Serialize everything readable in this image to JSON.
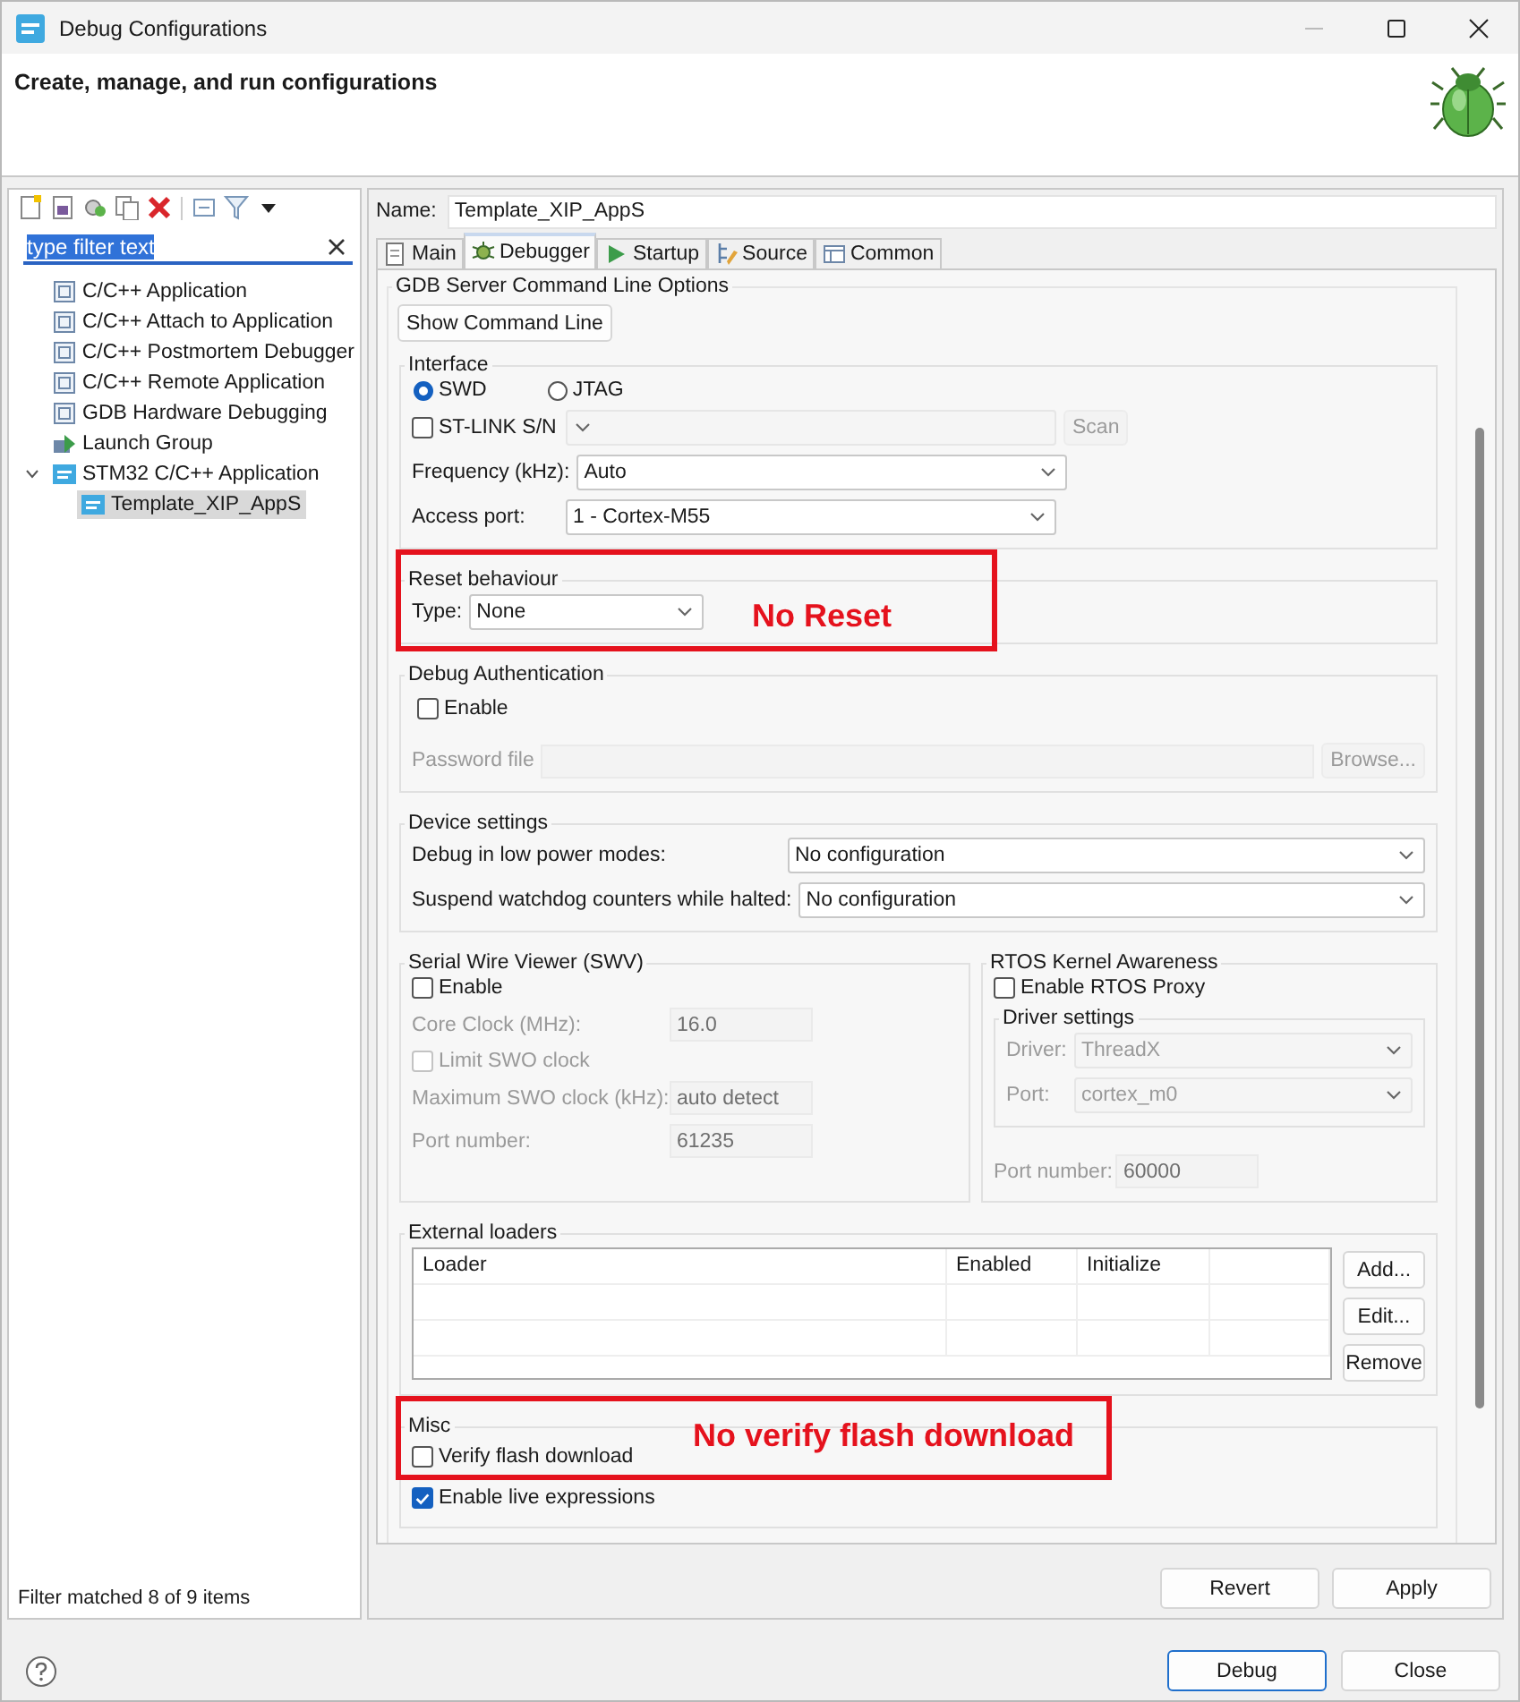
{
  "window": {
    "title": "Debug Configurations"
  },
  "header": {
    "title": "Create, manage, and run configurations"
  },
  "filter": {
    "value": "type filter text",
    "text_selected": true
  },
  "tree": [
    {
      "label": "C/C++ Application",
      "kind": "c",
      "selected": false
    },
    {
      "label": "C/C++ Attach to Application",
      "kind": "c",
      "selected": false
    },
    {
      "label": "C/C++ Postmortem Debugger",
      "kind": "c",
      "selected": false
    },
    {
      "label": "C/C++ Remote Application",
      "kind": "c",
      "selected": false
    },
    {
      "label": "GDB Hardware Debugging",
      "kind": "c",
      "selected": false
    },
    {
      "label": "Launch Group",
      "kind": "group",
      "selected": false
    },
    {
      "label": "STM32 C/C++ Application",
      "kind": "ide",
      "selected": false,
      "expanded": true,
      "children": [
        {
          "label": "Template_XIP_AppS",
          "kind": "ide",
          "selected": true
        }
      ]
    }
  ],
  "filter_status": "Filter matched 8 of 9 items",
  "name": {
    "label": "Name:",
    "value": "Template_XIP_AppS"
  },
  "tabs": [
    {
      "label": "Main",
      "kind": "page",
      "selected": false
    },
    {
      "label": "Debugger",
      "kind": "bug",
      "selected": true
    },
    {
      "label": "Startup",
      "kind": "play",
      "selected": false
    },
    {
      "label": "Source",
      "kind": "source",
      "selected": false
    },
    {
      "label": "Common",
      "kind": "table",
      "selected": false
    }
  ],
  "gdb_server": {
    "title": "GDB Server Command Line Options",
    "button": "Show Command Line"
  },
  "interface": {
    "title": "Interface",
    "radios": [
      {
        "label": "SWD",
        "selected": true
      },
      {
        "label": "JTAG",
        "selected": false
      }
    ],
    "stlink_sn": {
      "label": "ST-LINK S/N",
      "checked": false,
      "scan": "Scan"
    },
    "frequency": {
      "label": "Frequency (kHz):",
      "value": "Auto"
    },
    "access_port": {
      "label": "Access port:",
      "value": "1 - Cortex-M55"
    }
  },
  "reset": {
    "title": "Reset behaviour",
    "label": "Type:",
    "value": "None"
  },
  "debug_auth": {
    "title": "Debug Authentication",
    "enable": {
      "label": "Enable",
      "checked": false
    },
    "password_label": "Password file",
    "browse": "Browse..."
  },
  "device_settings": {
    "title": "Device settings",
    "rows": [
      {
        "label": "Debug in low power modes:",
        "value": "No configuration"
      },
      {
        "label": "Suspend watchdog counters while halted:",
        "value": "No configuration"
      }
    ]
  },
  "swv": {
    "title": "Serial Wire Viewer (SWV)",
    "enable": {
      "label": "Enable",
      "checked": false
    },
    "fields": [
      {
        "kind": "field",
        "label": "Core Clock (MHz):",
        "value": "16.0"
      },
      {
        "kind": "check",
        "label": "Limit SWO clock",
        "checked": false
      },
      {
        "kind": "field",
        "label": "Maximum SWO clock (kHz):",
        "value": "auto detect"
      },
      {
        "kind": "field",
        "label": "Port number:",
        "value": "61235"
      }
    ]
  },
  "rtos": {
    "title": "RTOS Kernel Awareness",
    "enable": {
      "label": "Enable RTOS Proxy",
      "checked": false
    },
    "driver_settings": {
      "title": "Driver settings",
      "rows": [
        {
          "label": "Driver:",
          "value": "ThreadX"
        },
        {
          "label": "Port:",
          "value": "cortex_m0"
        }
      ]
    },
    "port_number": {
      "label": "Port number:",
      "value": "60000"
    }
  },
  "external_loaders": {
    "title": "External loaders",
    "columns": [
      "Loader",
      "Enabled",
      "Initialize"
    ],
    "buttons": [
      "Add...",
      "Edit...",
      "Remove"
    ]
  },
  "misc": {
    "title": "Misc",
    "options": [
      {
        "label": "Verify flash download",
        "checked": false
      },
      {
        "label": "Enable live expressions",
        "checked": true
      }
    ]
  },
  "annotations": [
    {
      "text": "No Reset"
    },
    {
      "text": "No verify flash download"
    }
  ],
  "buttons": [
    "Revert",
    "Apply"
  ],
  "footer_buttons": [
    {
      "label": "Debug",
      "default": true
    },
    {
      "label": "Close",
      "default": false
    }
  ]
}
